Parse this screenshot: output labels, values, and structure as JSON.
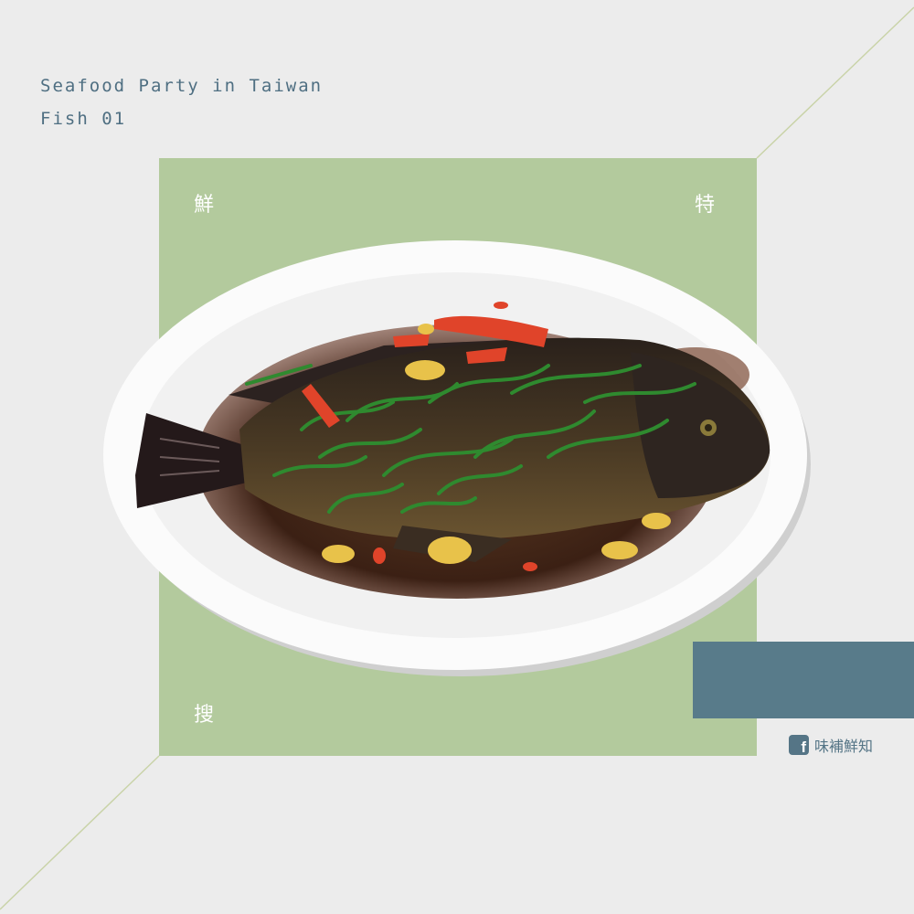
{
  "header": {
    "title": "Seafood Party in Taiwan",
    "subtitle": "Fish 01"
  },
  "card": {
    "corner_top_left": "鮮",
    "corner_top_right": "特",
    "corner_bottom_left": "搜"
  },
  "brand": {
    "icon": "facebook-icon",
    "icon_glyph": "f",
    "name": "味補鮮知"
  },
  "colors": {
    "background": "#ececec",
    "card_green": "#b3ca9d",
    "accent_blue": "#587b8a",
    "text_blue": "#4f6f82"
  },
  "illustration": "steamed-fish-on-plate"
}
